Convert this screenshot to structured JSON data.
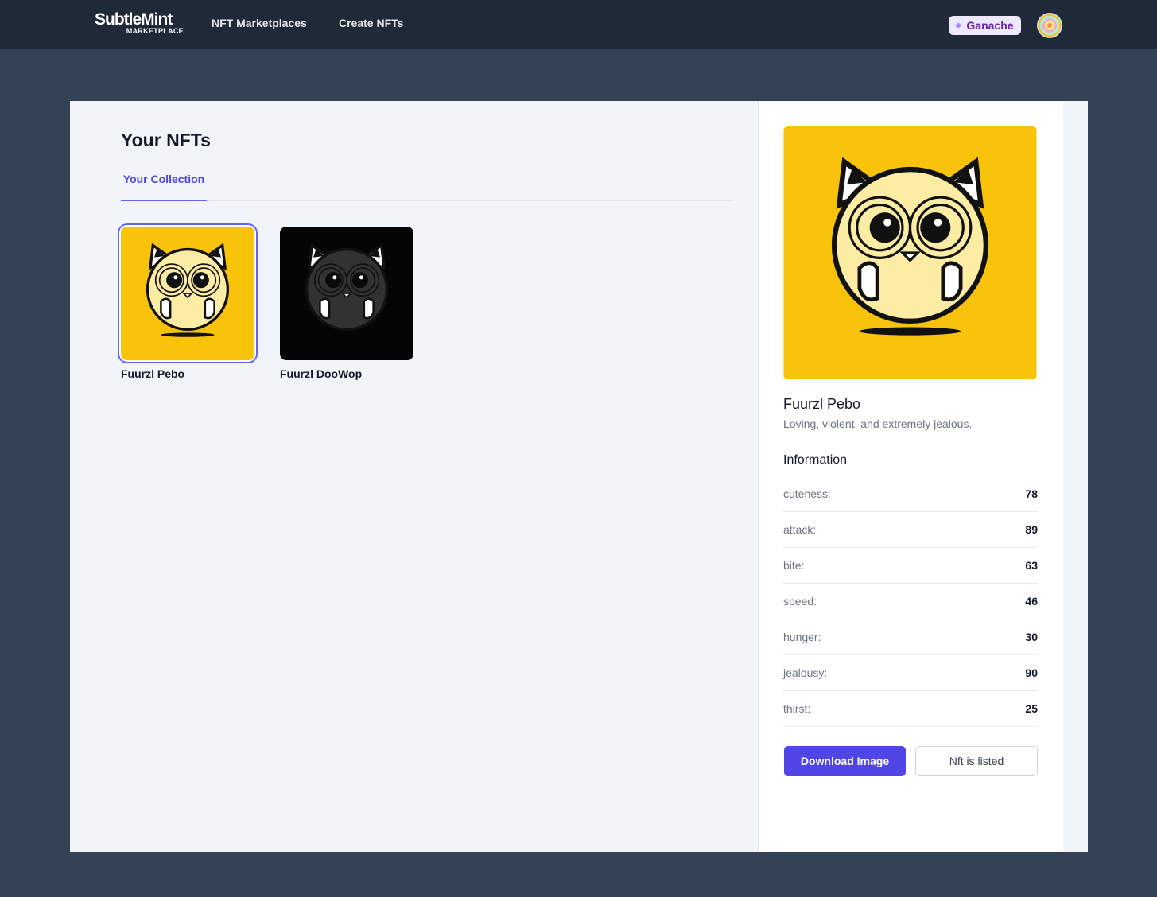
{
  "brand": {
    "name": "SubtleMint",
    "sub": "MARKETPLACE"
  },
  "nav": {
    "links": [
      "NFT Marketplaces",
      "Create NFTs"
    ]
  },
  "network": {
    "label": "Ganache",
    "color": "#a78bfa"
  },
  "page": {
    "title": "Your NFTs",
    "tab": "Your Collection"
  },
  "collection": [
    {
      "name": "Fuurzl Pebo",
      "bg": "#f8c30a",
      "body": "#fdeca3",
      "selected": true
    },
    {
      "name": "Fuurzl DooWop",
      "bg": "#050505",
      "body": "#2f3430",
      "selected": false
    }
  ],
  "detail": {
    "name": "Fuurzl Pebo",
    "description": "Loving, violent, and extremely jealous.",
    "info_title": "Information",
    "attributes": [
      {
        "key": "cuteness:",
        "value": "78"
      },
      {
        "key": "attack:",
        "value": "89"
      },
      {
        "key": "bite:",
        "value": "63"
      },
      {
        "key": "speed:",
        "value": "46"
      },
      {
        "key": "hunger:",
        "value": "30"
      },
      {
        "key": "jealousy:",
        "value": "90"
      },
      {
        "key": "thirst:",
        "value": "25"
      }
    ],
    "buttons": {
      "download": "Download Image",
      "listed": "Nft is listed"
    }
  },
  "colors": {
    "accent": "#4f46e5",
    "nav_bg": "#1f2937",
    "page_bg": "#334155"
  }
}
